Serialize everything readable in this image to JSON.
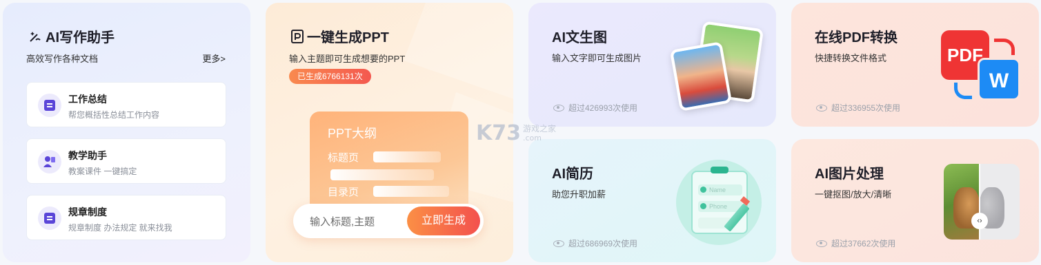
{
  "writing": {
    "title": "AI写作助手",
    "subtitle": "高效写作各种文档",
    "more": "更多>",
    "items": [
      {
        "title": "工作总结",
        "desc": "帮您概括性总结工作内容",
        "icon": "document-edit-icon"
      },
      {
        "title": "教学助手",
        "desc": "教案课件 一键搞定",
        "icon": "teacher-icon"
      },
      {
        "title": "规章制度",
        "desc": "规章制度 办法规定 就来找我",
        "icon": "document-edit-icon"
      }
    ]
  },
  "ppt": {
    "title": "一键生成PPT",
    "subtitle": "输入主题即可生成想要的PPT",
    "badge": "已生成6766131次",
    "outline_title": "PPT大纲",
    "outline_lines": [
      "标题页",
      "目录页"
    ],
    "input_placeholder": "输入标题,主题",
    "button": "立即生成"
  },
  "text2img": {
    "title": "AI文生图",
    "subtitle": "输入文字即可生成图片",
    "usage": "超过426993次使用"
  },
  "pdf": {
    "title": "在线PDF转换",
    "subtitle": "快捷转换文件格式",
    "usage": "超过336955次使用",
    "pdf_label": "PDF",
    "word_label": "W"
  },
  "resume": {
    "title": "AI简历",
    "subtitle": "助您升职加薪",
    "usage": "超过686969次使用",
    "field_name": "Name",
    "field_phone": "Phone"
  },
  "image": {
    "title": "AI图片处理",
    "subtitle": "一键抠图/放大/清晰",
    "usage": "超过37662次使用",
    "knob": "‹›"
  },
  "watermark": {
    "main": "K73",
    "sub": "游戏之家",
    "url": ".com"
  },
  "colors": {
    "accent_orange": "#f4584f",
    "accent_purple": "#5a45d8",
    "pdf_red": "#ef3434",
    "word_blue": "#1d8bf5"
  }
}
